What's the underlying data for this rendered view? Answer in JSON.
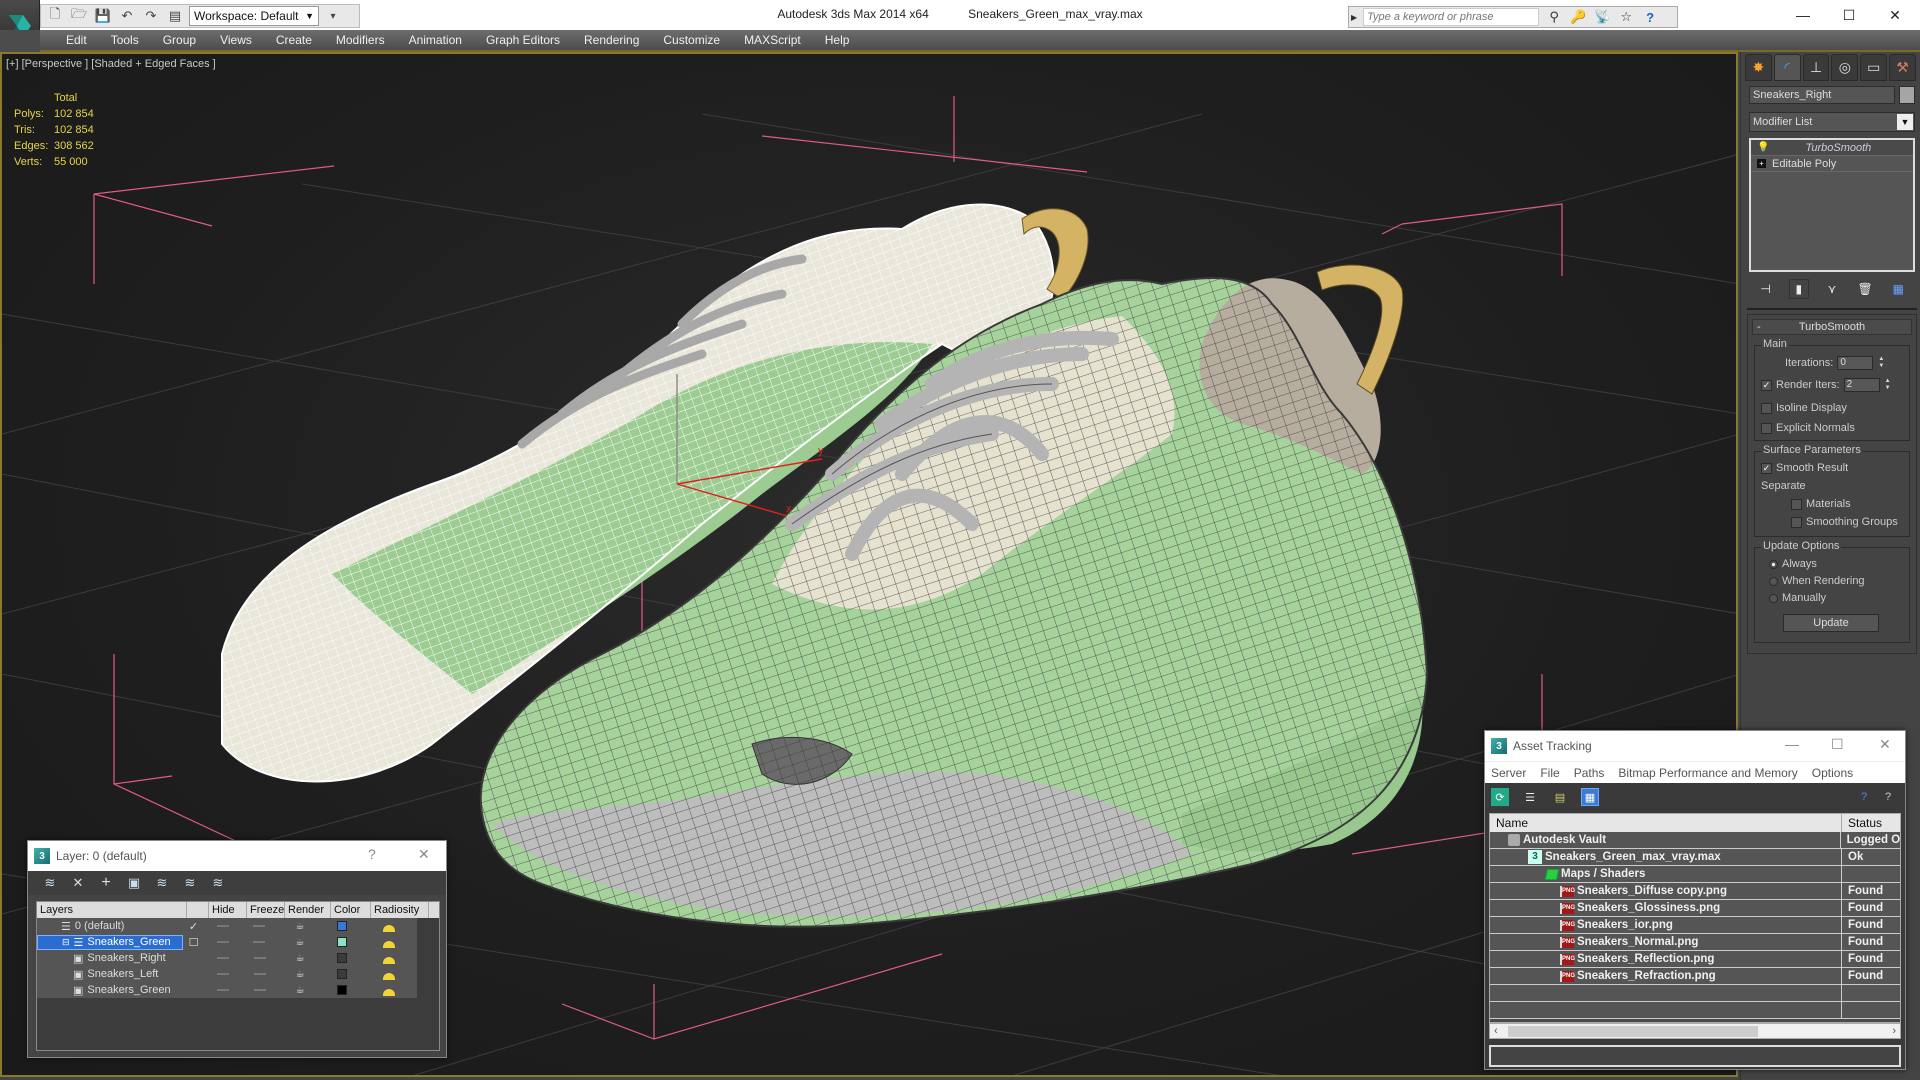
{
  "window": {
    "app_title": "Autodesk 3ds Max  2014 x64",
    "file_title": "Sneakers_Green_max_vray.max",
    "minimize": "—",
    "maximize": "☐",
    "close": "✕"
  },
  "quick_access": {
    "workspace_label": "Workspace: Default",
    "icons": [
      "new-file-icon",
      "open-file-icon",
      "save-icon",
      "undo-icon",
      "redo-icon",
      "project-folder-icon"
    ]
  },
  "search": {
    "placeholder": "Type a keyword or phrase",
    "icons": [
      "binoculars-icon",
      "key-icon",
      "satellite-icon",
      "star-icon",
      "help-icon"
    ]
  },
  "menu": [
    "Edit",
    "Tools",
    "Group",
    "Views",
    "Create",
    "Modifiers",
    "Animation",
    "Graph Editors",
    "Rendering",
    "Customize",
    "MAXScript",
    "Help"
  ],
  "viewport": {
    "label": "[+] [Perspective ] [Shaded + Edged Faces ]",
    "stats": {
      "header": "Total",
      "rows": [
        {
          "key": "Polys:",
          "value": "102 854"
        },
        {
          "key": "Tris:",
          "value": "102 854"
        },
        {
          "key": "Edges:",
          "value": "308 562"
        },
        {
          "key": "Verts:",
          "value": "55 000"
        }
      ]
    },
    "gizmo": {
      "x_label": "x",
      "y_label": "y"
    },
    "colors": {
      "upper_green": "#a8d4a0",
      "cream": "#e8e4d4",
      "heel_gray": "#b8b0a4",
      "strap_gold": "#d4b464",
      "bbox_pink": "#e05a8a",
      "wire_dark": "#3a3a3a"
    }
  },
  "command_panel": {
    "tabs": [
      "create-tab",
      "modify-tab",
      "hierarchy-tab",
      "motion-tab",
      "display-tab",
      "utilities-tab"
    ],
    "object_name": "Sneakers_Right",
    "modifier_list": "Modifier List",
    "stack": [
      {
        "label": "TurboSmooth",
        "type": "modifier"
      },
      {
        "label": "Editable Poly",
        "type": "base"
      }
    ],
    "rollout": {
      "title": "TurboSmooth",
      "main_group": "Main",
      "iterations_label": "Iterations:",
      "iterations_value": "0",
      "render_iters_label": "Render Iters:",
      "render_iters_value": "2",
      "render_iters_checked": true,
      "isoline_display": "Isoline Display",
      "explicit_normals": "Explicit Normals",
      "surface_group": "Surface Parameters",
      "smooth_result": "Smooth Result",
      "separate_label": "Separate",
      "materials": "Materials",
      "smoothing_groups": "Smoothing Groups",
      "update_group": "Update Options",
      "always": "Always",
      "when_rendering": "When Rendering",
      "manually": "Manually",
      "update_button": "Update"
    }
  },
  "layer_window": {
    "title": "Layer: 0 (default)",
    "help": "?",
    "close": "✕",
    "columns": [
      "Layers",
      "",
      "Hide",
      "Freeze",
      "Render",
      "Color",
      "Radiosity"
    ],
    "rows": [
      {
        "name": "0 (default)",
        "current": "✓",
        "color": "#3a78d8",
        "type": "layer"
      },
      {
        "name": "Sneakers_Green",
        "current": "☐",
        "color": "#8ee0c8",
        "type": "layer",
        "selected": true
      },
      {
        "name": "Sneakers_Right",
        "current": "",
        "color": "#3c3c3c",
        "type": "object"
      },
      {
        "name": "Sneakers_Left",
        "current": "",
        "color": "#3c3c3c",
        "type": "object"
      },
      {
        "name": "Sneakers_Green",
        "current": "",
        "color": "#000000",
        "type": "object"
      }
    ]
  },
  "asset_window": {
    "title": "Asset Tracking",
    "menu": [
      "Server",
      "File",
      "Paths",
      "Bitmap Performance and Memory",
      "Options"
    ],
    "columns": [
      "Name",
      "Status"
    ],
    "rows": [
      {
        "name": "Autodesk Vault",
        "status": "Logged O",
        "level": 1,
        "icon": "vault"
      },
      {
        "name": "Sneakers_Green_max_vray.max",
        "status": "Ok",
        "level": 2,
        "icon": "max"
      },
      {
        "name": "Maps / Shaders",
        "status": "",
        "level": 3,
        "icon": "maps"
      },
      {
        "name": "Sneakers_Diffuse copy.png",
        "status": "Found",
        "level": 4,
        "icon": "png"
      },
      {
        "name": "Sneakers_Glossiness.png",
        "status": "Found",
        "level": 4,
        "icon": "png"
      },
      {
        "name": "Sneakers_ior.png",
        "status": "Found",
        "level": 4,
        "icon": "png"
      },
      {
        "name": "Sneakers_Normal.png",
        "status": "Found",
        "level": 4,
        "icon": "png"
      },
      {
        "name": "Sneakers_Reflection.png",
        "status": "Found",
        "level": 4,
        "icon": "png"
      },
      {
        "name": "Sneakers_Refraction.png",
        "status": "Found",
        "level": 4,
        "icon": "png"
      }
    ]
  }
}
